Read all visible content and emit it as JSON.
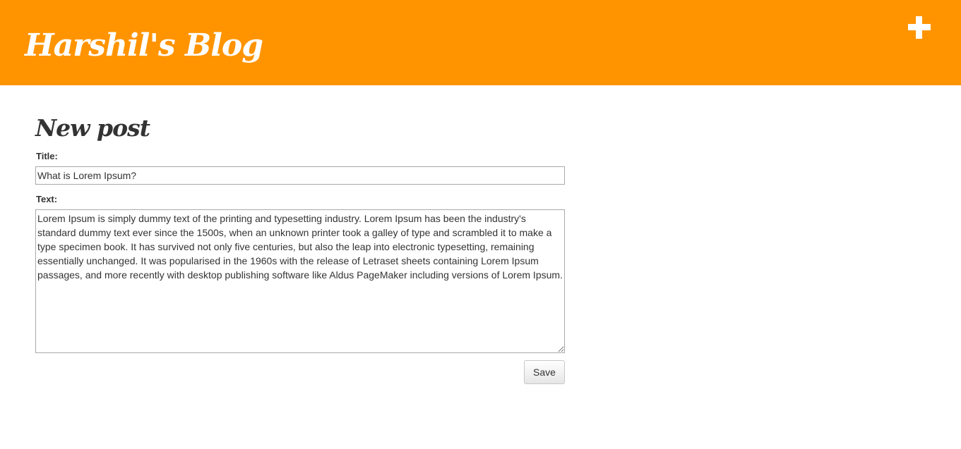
{
  "header": {
    "blog_title": "Harshil's Blog",
    "add_icon": "plus-icon",
    "background_color": "#ff9400"
  },
  "form": {
    "heading": "New post",
    "title_label": "Title:",
    "title_value": "What is Lorem Ipsum?",
    "text_label": "Text:",
    "text_value": "Lorem Ipsum is simply dummy text of the printing and typesetting industry. Lorem Ipsum has been the industry's standard dummy text ever since the 1500s, when an unknown printer took a galley of type and scrambled it to make a type specimen book. It has survived not only five centuries, but also the leap into electronic typesetting, remaining essentially unchanged. It was popularised in the 1960s with the release of Letraset sheets containing Lorem Ipsum passages, and more recently with desktop publishing software like Aldus PageMaker including versions of Lorem Ipsum.",
    "save_label": "Save"
  }
}
